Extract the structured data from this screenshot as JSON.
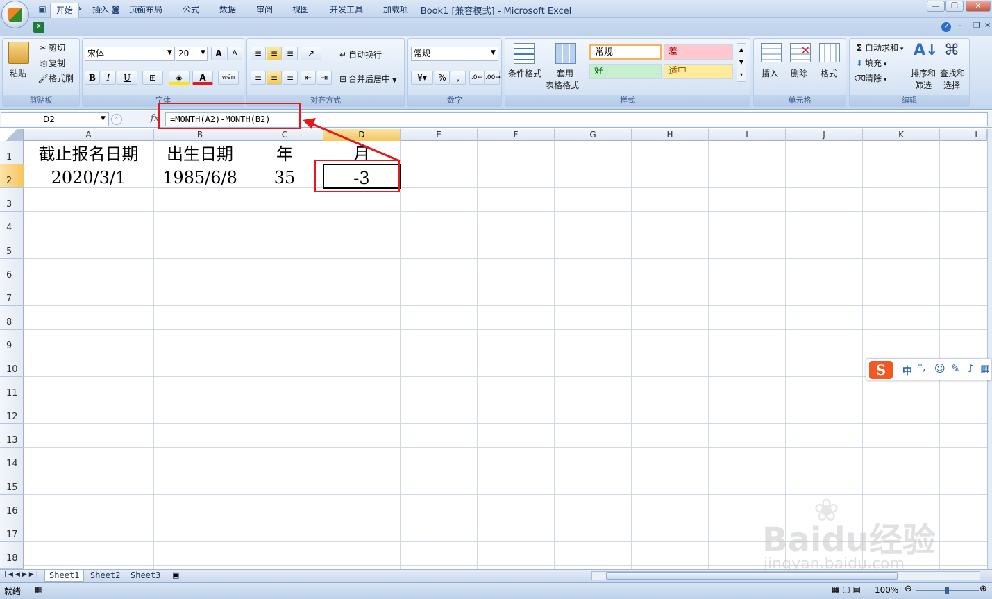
{
  "title": "Book1  [兼容模式] - Microsoft Excel",
  "tabs": [
    "开始",
    "插入",
    "页面布局",
    "公式",
    "数据",
    "审阅",
    "视图",
    "开发工具",
    "加载项"
  ],
  "ribbon": {
    "clipboard": {
      "paste": "粘贴",
      "cut": "剪切",
      "copy": "复制",
      "format_painter": "格式刷",
      "label": "剪贴板"
    },
    "font": {
      "name": "宋体",
      "size": "20",
      "label": "字体",
      "bold": "B",
      "italic": "I",
      "underline": "U",
      "grow": "A",
      "shrink": "A",
      "font_color": "A",
      "phonetic": "wén"
    },
    "alignment": {
      "wrap": "自动换行",
      "merge": "合并后居中",
      "label": "对齐方式"
    },
    "number": {
      "format": "常规",
      "percent": "%",
      "comma": ",",
      "label": "数字"
    },
    "styles": {
      "conditional": "条件格式",
      "table_line1": "套用",
      "table_line2": "表格格式",
      "normal": "常规",
      "bad": "差",
      "good": "好",
      "neutral": "适中",
      "label": "样式"
    },
    "cells": {
      "insert": "插入",
      "delete": "删除",
      "format": "格式",
      "label": "单元格"
    },
    "editing": {
      "autosum": "自动求和",
      "fill": "填充",
      "clear": "清除",
      "sort_line1": "排序和",
      "sort_line2": "筛选",
      "find_line1": "查找和",
      "find_line2": "选择",
      "label": "编辑"
    }
  },
  "name_box": "D2",
  "fx": "fx",
  "formula": "=MONTH(A2)-MONTH(B2)",
  "columns": [
    "A",
    "B",
    "C",
    "D",
    "E",
    "F",
    "G",
    "H",
    "I",
    "J",
    "K",
    "L"
  ],
  "rows": [
    "1",
    "2",
    "3",
    "4",
    "5",
    "6",
    "7",
    "8",
    "9",
    "10",
    "11",
    "12",
    "13",
    "14",
    "15",
    "16",
    "17",
    "18"
  ],
  "cells": {
    "A1": "截止报名日期",
    "B1": "出生日期",
    "C1": "年",
    "D1": "月",
    "A2": "2020/3/1",
    "B2": "1985/6/8",
    "C2": "35",
    "D2": "-3"
  },
  "sheets": [
    "Sheet1",
    "Sheet2",
    "Sheet3"
  ],
  "status": {
    "ready": "就绪",
    "zoom": "100%"
  },
  "ime": {
    "mode": "中",
    "punct": "°,"
  },
  "watermark": {
    "brand": "Baidu经验",
    "url": "jingyan.baidu.com"
  },
  "colors": {
    "accent": "#e3191e",
    "selected_header": "#f5c65f"
  }
}
